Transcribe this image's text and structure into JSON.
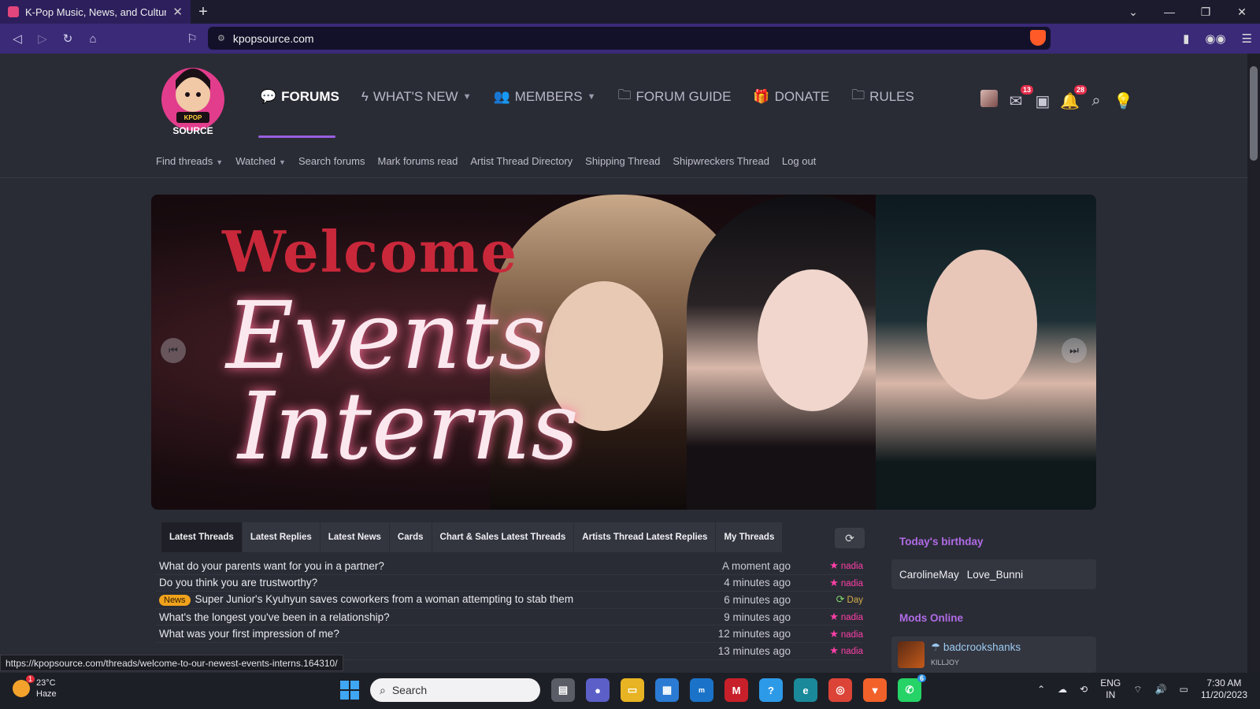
{
  "browser": {
    "tab_title": "K-Pop Music, News, and Culture",
    "url": "kpopsource.com"
  },
  "logo": {
    "line1": "KPOP",
    "line2": "SOURCE"
  },
  "main_nav": [
    {
      "label": "FORUMS",
      "icon": "forums-icon",
      "active": true,
      "dropdown": false
    },
    {
      "label": "WHAT'S NEW",
      "icon": "lightning-icon",
      "active": false,
      "dropdown": true
    },
    {
      "label": "MEMBERS",
      "icon": "members-icon",
      "active": false,
      "dropdown": true
    },
    {
      "label": "FORUM GUIDE",
      "icon": "folder-icon",
      "active": false,
      "dropdown": false
    },
    {
      "label": "DONATE",
      "icon": "gift-icon",
      "active": false,
      "dropdown": false
    },
    {
      "label": "RULES",
      "icon": "folder-icon",
      "active": false,
      "dropdown": false
    }
  ],
  "user_icons": {
    "inbox_count": "13",
    "alerts_count": "28"
  },
  "sub_nav": [
    {
      "label": "Find threads",
      "dropdown": true
    },
    {
      "label": "Watched",
      "dropdown": true
    },
    {
      "label": "Search forums",
      "dropdown": false
    },
    {
      "label": "Mark forums read",
      "dropdown": false
    },
    {
      "label": "Artist Thread Directory",
      "dropdown": false
    },
    {
      "label": "Shipping Thread",
      "dropdown": false
    },
    {
      "label": "Shipwreckers Thread",
      "dropdown": false
    },
    {
      "label": "Log out",
      "dropdown": false
    }
  ],
  "banner": {
    "line1": "Welcome",
    "line2": "Events",
    "line3": "Interns"
  },
  "thread_tabs": [
    "Latest Threads",
    "Latest Replies",
    "Latest News",
    "Cards",
    "Chart & Sales Latest Threads",
    "Artists Thread Latest Replies",
    "My Threads"
  ],
  "threads": [
    {
      "title": "What do your parents want for you in a partner?",
      "time": "A moment ago",
      "by": "nadia",
      "tag": ""
    },
    {
      "title": "Do you think you are trustworthy?",
      "time": "4 minutes ago",
      "by": "nadia",
      "tag": ""
    },
    {
      "title": "Super Junior's Kyuhyun saves coworkers from a woman attempting to stab them",
      "time": "6 minutes ago",
      "by": "Day",
      "tag": "News"
    },
    {
      "title": "What's the longest you've been in a relationship?",
      "time": "9 minutes ago",
      "by": "nadia",
      "tag": ""
    },
    {
      "title": "What was your first impression of me?",
      "time": "12 minutes ago",
      "by": "nadia",
      "tag": ""
    },
    {
      "title": "",
      "time": "13 minutes ago",
      "by": "nadia",
      "tag": ""
    }
  ],
  "sidebar": {
    "birthday_title": "Today's birthday",
    "birthdays": [
      "CarolineMay",
      "Love_Bunni"
    ],
    "mods_title": "Mods Online",
    "mod_name": "badcrookshanks",
    "mod_sub": "KILLJOY"
  },
  "status_url": "https://kpopsource.com/threads/welcome-to-our-newest-events-interns.164310/",
  "taskbar": {
    "temp": "23°C",
    "weather": "Haze",
    "weather_badge": "1",
    "search_placeholder": "Search",
    "whatsapp_badge": "6",
    "lang1": "ENG",
    "lang2": "IN",
    "time": "7:30 AM",
    "date": "11/20/2023"
  },
  "colors": {
    "accent": "#9a5fe0",
    "author_pink": "#ff3fa8",
    "news_tag": "#f0a21c",
    "sidebar_title": "#b06be6"
  }
}
